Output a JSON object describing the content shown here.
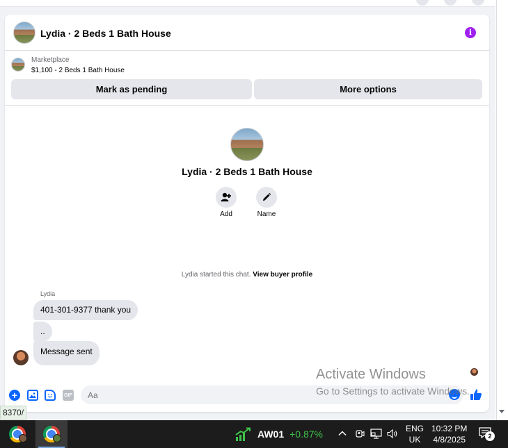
{
  "header": {
    "title": "Lydia · 2 Beds 1 Bath House",
    "info_glyph": "i"
  },
  "marketplace": {
    "label": "Marketplace",
    "item": "$1,100 - 2 Beds 1 Bath House",
    "mark_pending": "Mark as pending",
    "more_options": "More options"
  },
  "intro": {
    "title": "Lydia · 2 Beds 1 Bath House",
    "add_label": "Add",
    "name_label": "Name"
  },
  "thread": {
    "started_text": "Lydia started this chat.",
    "buyer_profile_link": "View buyer profile",
    "sender_name": "Lydia",
    "messages": [
      {
        "text": "401-301-9377 thank you"
      },
      {
        "text": ".."
      },
      {
        "text": "Message sent"
      }
    ]
  },
  "composer": {
    "placeholder": "Aa",
    "gif_label": "GIF"
  },
  "watermark": {
    "line1": "Activate Windows",
    "line2": "Go to Settings to activate Windows."
  },
  "status_url": "8370/",
  "taskbar": {
    "stock_name": "AW01",
    "stock_change": "+0.87%",
    "lang_line1": "ENG",
    "lang_line2": "UK",
    "time": "10:32 PM",
    "date": "4/8/2025",
    "notification_count": "2"
  },
  "colors": {
    "accent": "#0866ff",
    "info_purple": "#a020f0",
    "stock_up": "#3ec34a"
  },
  "icons": [
    "info-icon",
    "add-person-icon",
    "pencil-icon",
    "plus-icon",
    "photo-icon",
    "sticker-icon",
    "gif-icon",
    "emoji-icon",
    "thumbs-up-icon",
    "chrome-icon",
    "stock-chart-icon",
    "chevron-up-icon",
    "meet-now-icon",
    "network-icon",
    "volume-icon",
    "notification-icon"
  ]
}
